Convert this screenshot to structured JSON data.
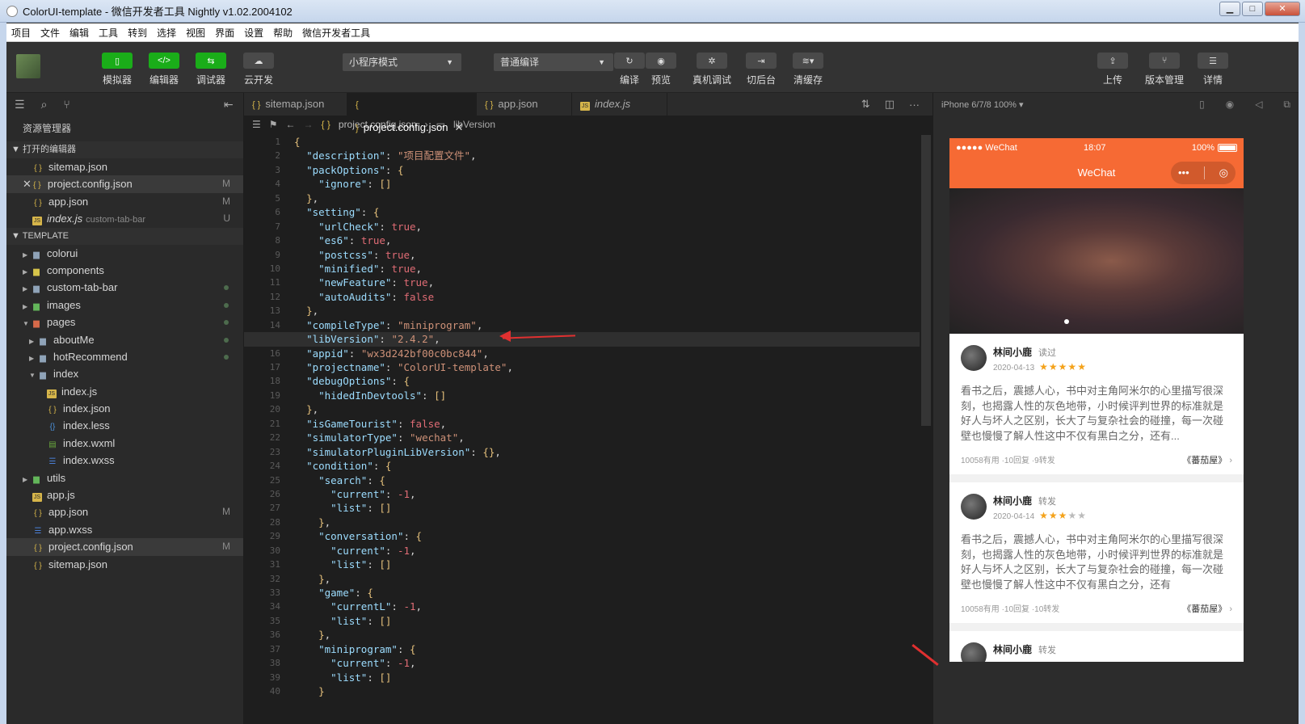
{
  "window": {
    "title": "ColorUI-template - 微信开发者工具 Nightly v1.02.2004102",
    "btn_min": "▁",
    "btn_max": "□",
    "btn_close": "✕"
  },
  "menu": [
    "项目",
    "文件",
    "编辑",
    "工具",
    "转到",
    "选择",
    "视图",
    "界面",
    "设置",
    "帮助",
    "微信开发者工具"
  ],
  "toolbar": {
    "simulator": "模拟器",
    "editor": "编辑器",
    "debugger": "调试器",
    "cloud": "云开发",
    "mode": "小程序模式",
    "compile_mode": "普通编译",
    "compile": "编译",
    "preview": "预览",
    "remote_debug": "真机调试",
    "backend": "切后台",
    "clear_cache": "清缓存",
    "upload": "上传",
    "version": "版本管理",
    "details": "详情"
  },
  "sidebar": {
    "title": "资源管理器",
    "open_editors": "打开的编辑器",
    "open_files": [
      {
        "name": "sitemap.json",
        "badge": ""
      },
      {
        "name": "project.config.json",
        "badge": "M"
      },
      {
        "name": "app.json",
        "badge": "M"
      },
      {
        "name": "index.js",
        "sub": "custom-tab-bar",
        "badge": "U"
      }
    ],
    "template": "TEMPLATE",
    "tree": {
      "colorui": "colorui",
      "components": "components",
      "custom_tab_bar": "custom-tab-bar",
      "images": "images",
      "pages": "pages",
      "aboutMe": "aboutMe",
      "hotRecommend": "hotRecommend",
      "index": "index",
      "index_js": "index.js",
      "index_json": "index.json",
      "index_less": "index.less",
      "index_wxml": "index.wxml",
      "index_wxss": "index.wxss",
      "utils": "utils",
      "app_js": "app.js",
      "app_json": "app.json",
      "app_json_badge": "M",
      "app_wxss": "app.wxss",
      "project_config": "project.config.json",
      "project_config_badge": "M",
      "sitemap": "sitemap.json"
    }
  },
  "tabs": [
    {
      "name": "sitemap.json"
    },
    {
      "name": "project.config.json"
    },
    {
      "name": "app.json"
    },
    {
      "name": "index.js"
    }
  ],
  "breadcrumb": {
    "file": "project.config.json",
    "key": "libVersion"
  },
  "simulator": {
    "device": "iPhone 6/7/8 100% ▾",
    "status_left": "●●●●● WeChat",
    "status_time": "18:07",
    "status_batt": "100%",
    "nav_title": "WeChat",
    "posts": [
      {
        "name": "林间小鹿",
        "tag": "读过",
        "date": "2020-04-13",
        "stars_on": "★★★★★",
        "stars_off": "",
        "text": "看书之后，震撼人心，书中对主角阿米尔的心里描写很深刻，也揭露人性的灰色地带，小时候评判世界的标准就是好人与坏人之区别，长大了与复杂社会的碰撞，每一次碰壁也慢慢了解人性这中不仅有黑白之分，还有...",
        "stats": "10058有用 ·10回复 ·9转发",
        "book": "《蕃茄屋》"
      },
      {
        "name": "林间小鹿",
        "tag": "转发",
        "date": "2020-04-14",
        "stars_on": "★★★",
        "stars_off": "★★",
        "text": "看书之后，震撼人心，书中对主角阿米尔的心里描写很深刻，也揭露人性的灰色地带，小时候评判世界的标准就是好人与坏人之区别，长大了与复杂社会的碰撞，每一次碰壁也慢慢了解人性这中不仅有黑白之分，还有",
        "stats": "10058有用 ·10回复 ·10转发",
        "book": "《蕃茄屋》"
      },
      {
        "name": "林间小鹿",
        "tag": "转发"
      }
    ]
  },
  "code_lines": [
    "{",
    "  \"description\": \"项目配置文件\",",
    "  \"packOptions\": {",
    "    \"ignore\": []",
    "  },",
    "  \"setting\": {",
    "    \"urlCheck\": true,",
    "    \"es6\": true,",
    "    \"postcss\": true,",
    "    \"minified\": true,",
    "    \"newFeature\": true,",
    "    \"autoAudits\": false",
    "  },",
    "  \"compileType\": \"miniprogram\",",
    "  \"libVersion\": \"2.4.2\",",
    "  \"appid\": \"wx3d242bf00c0bc844\",",
    "  \"projectname\": \"ColorUI-template\",",
    "  \"debugOptions\": {",
    "    \"hidedInDevtools\": []",
    "  },",
    "  \"isGameTourist\": false,",
    "  \"simulatorType\": \"wechat\",",
    "  \"simulatorPluginLibVersion\": {},",
    "  \"condition\": {",
    "    \"search\": {",
    "      \"current\": -1,",
    "      \"list\": []",
    "    },",
    "    \"conversation\": {",
    "      \"current\": -1,",
    "      \"list\": []",
    "    },",
    "    \"game\": {",
    "      \"currentL\": -1,",
    "      \"list\": []",
    "    },",
    "    \"miniprogram\": {",
    "      \"current\": -1,",
    "      \"list\": []",
    "    }"
  ],
  "colors": {
    "accent_green": "#1aad19",
    "wechat_orange": "#f66a34",
    "arrow_red": "#e03030"
  }
}
